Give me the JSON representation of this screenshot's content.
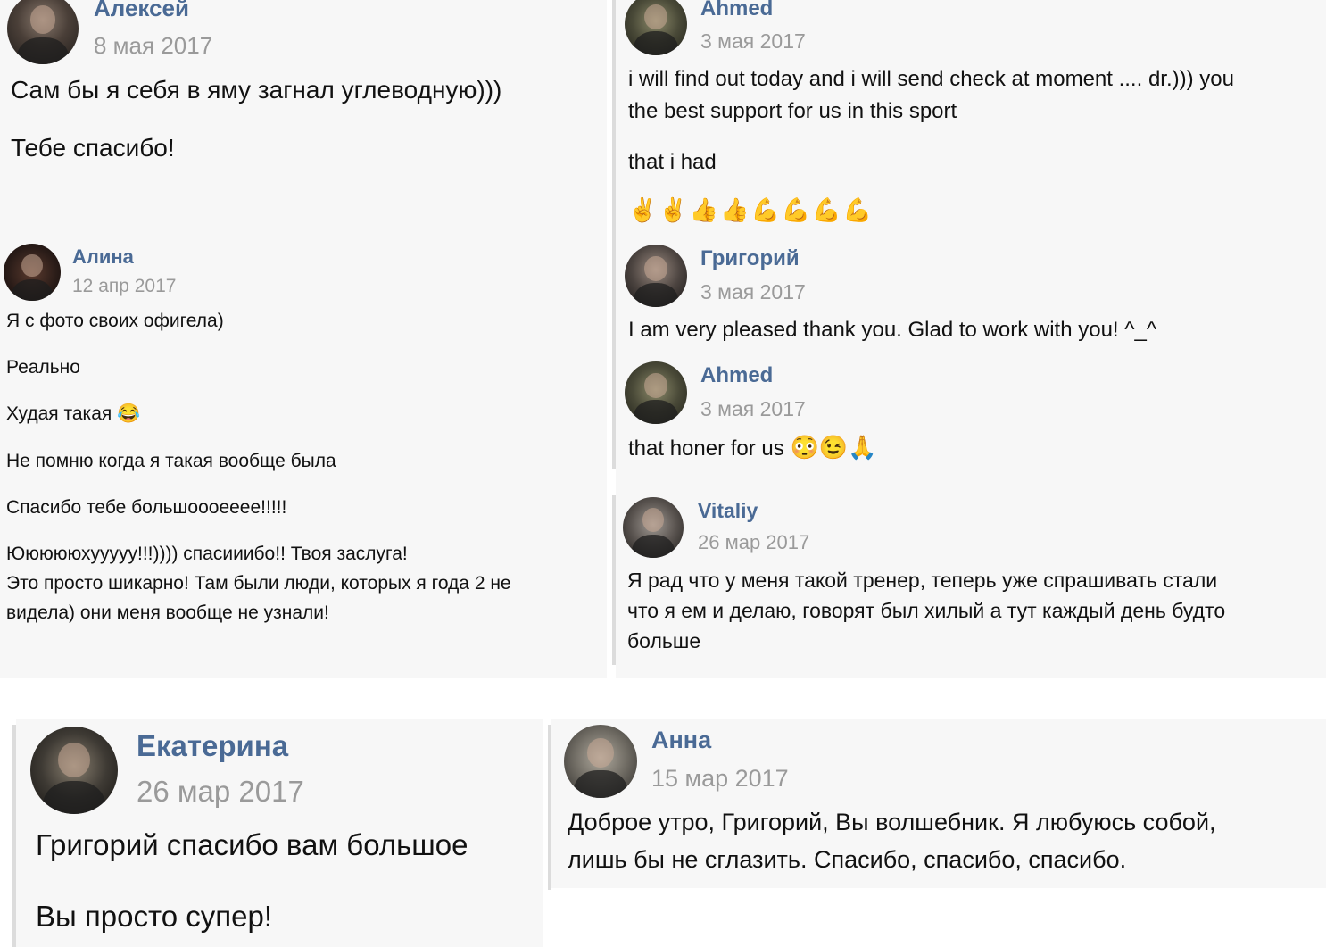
{
  "reviews": [
    {
      "id": "aleksey",
      "author": "Алексей",
      "date": "8 мая 2017",
      "lines": [
        "Сам бы я себя в яму загнал углеводную)))",
        "Тебе спасибо!"
      ]
    },
    {
      "id": "alina",
      "author": "Алина",
      "date": "12 апр 2017",
      "lines": [
        "Я с фото своих офигела)",
        "Реально",
        "Худая такая",
        "Не помню когда я такая вообще была",
        "Спасибо тебе большоооееее!!!!!",
        "Юююююхууууу!!!)))) спасииибо!! Твоя заслуга!",
        "Это просто шикарно! Там были люди, которых я года 2 не",
        "видела) они меня вообще не узнали!"
      ],
      "emoji": "😂"
    },
    {
      "id": "ahmed-1",
      "author": "Ahmed",
      "date": "3 мая 2017",
      "lines": [
        "i will find out today and i will send check at moment .... dr.))) you",
        "the best support for us in this sport",
        "that i had"
      ],
      "emoji_row": "✌️✌️👍👍💪💪💪💪"
    },
    {
      "id": "grigoriy",
      "author": "Григорий",
      "date": "3 мая 2017",
      "lines": [
        "I am very pleased thank you. Glad to work with you! ^_^"
      ]
    },
    {
      "id": "ahmed-2",
      "author": "Ahmed",
      "date": "3 мая 2017",
      "lines": [
        "that honer for us"
      ],
      "emoji_row": "😳😉🙏"
    },
    {
      "id": "vitaliy",
      "author": "Vitaliy",
      "date": "26 мар 2017",
      "lines": [
        "Я рад что у меня такой тренер, теперь уже спрашивать стали",
        "что я ем и делаю, говорят был хилый а тут каждый день будто",
        "больше"
      ]
    },
    {
      "id": "ekaterina",
      "author": "Екатерина",
      "date": "26 мар 2017",
      "lines": [
        "Григорий спасибо вам большое",
        "Вы просто супер!"
      ]
    },
    {
      "id": "anna",
      "author": "Анна",
      "date": "15 мар 2017",
      "lines": [
        "Доброе утро, Григорий, Вы волшебник. Я любуюсь собой,",
        "лишь бы не сглазить. Спасибо, спасибо, спасибо."
      ]
    }
  ],
  "colors": {
    "name": "#4a6a95",
    "date": "#9a9a9a",
    "text": "#111111",
    "divider": "#dcdcdc"
  }
}
